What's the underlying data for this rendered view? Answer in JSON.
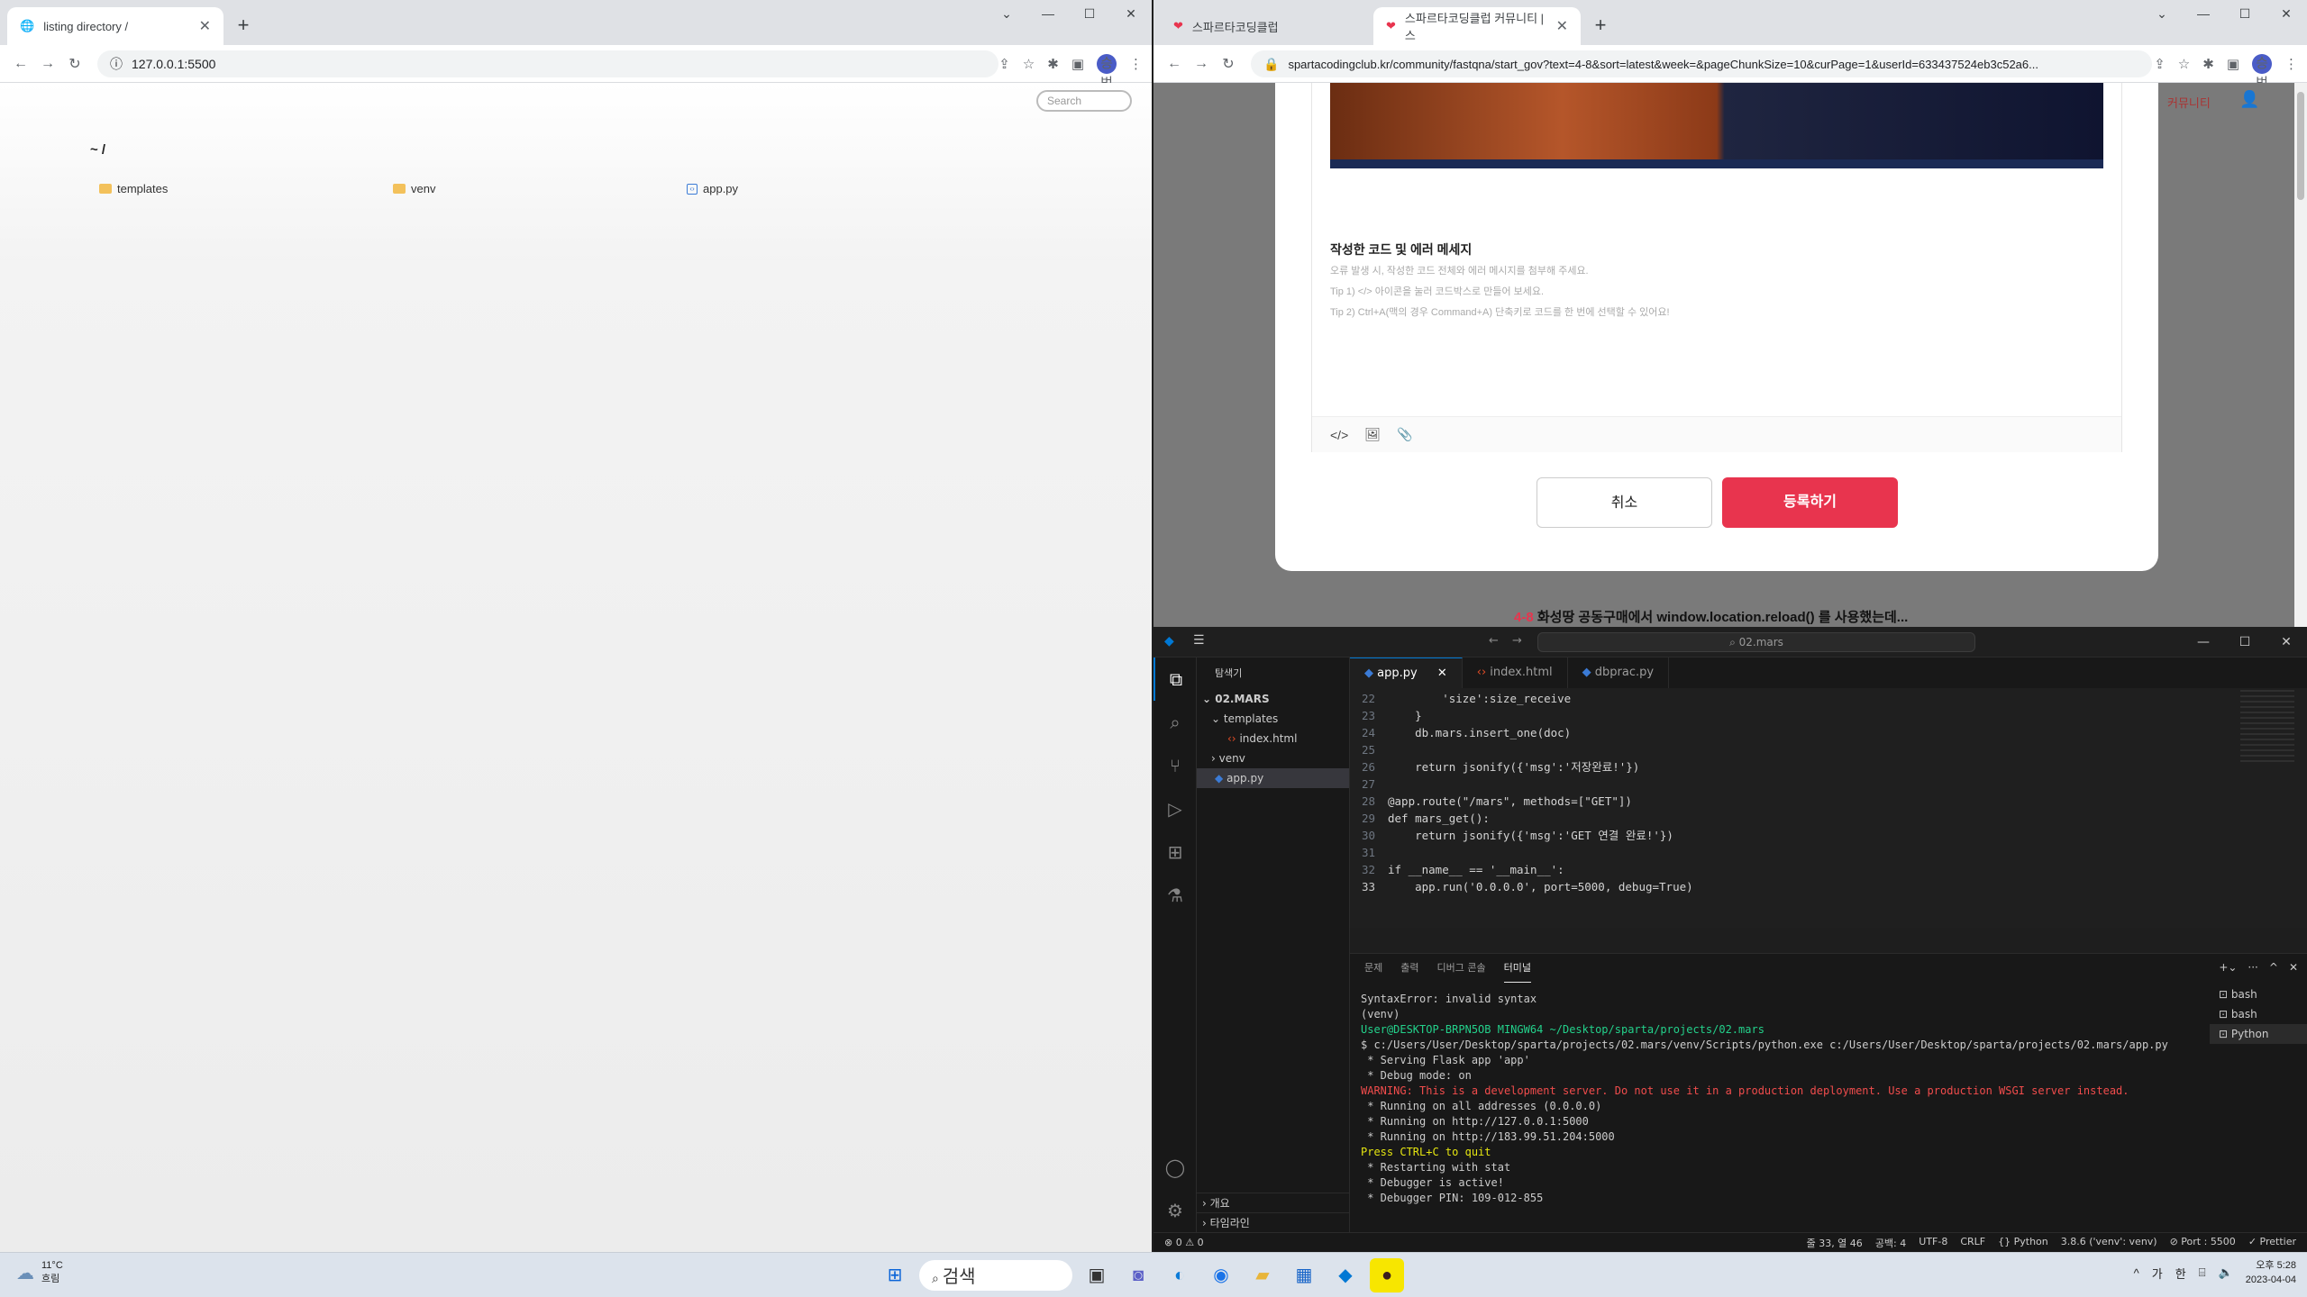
{
  "left_browser": {
    "tab_title": "listing directory /",
    "url": "127.0.0.1:5500",
    "avatar": "승범",
    "page": {
      "search_placeholder": "Search",
      "heading": "~ /",
      "items": [
        {
          "name": "templates",
          "type": "folder"
        },
        {
          "name": "venv",
          "type": "folder"
        },
        {
          "name": "app.py",
          "type": "file"
        }
      ]
    }
  },
  "right_browser": {
    "tabs": [
      "스파르타코딩클럽",
      "스파르타코딩클럽 커뮤니티 | 스"
    ],
    "url": "spartacodingclub.kr/community/fastqna/start_gov?text=4-8&sort=latest&week=&pageChunkSize=10&curPage=1&userId=633437524eb3c52a6...",
    "avatar": "승범",
    "bg_nav": "커뮤니티",
    "section_title": "작성한 코드 및 에러 메세지",
    "hints": [
      "오류 발생 시, 작성한 코드 전체와 에러 메시지를 첨부해 주세요.",
      "Tip 1) </> 아이콘을 눌러 코드박스로 만들어 보세요.",
      "Tip 2) Ctrl+A(맥의 경우 Command+A) 단축키로 코드를 한 번에 선택할 수 있어요!"
    ],
    "cancel_label": "취소",
    "submit_label": "등록하기",
    "below_prefix": "4-8",
    "below_text": " 화성땅 공동구매에서 window.location.reload() 를 사용했는데..."
  },
  "vscode": {
    "command_center": "02.mars",
    "explorer_title": "탐색기",
    "folder": "02.MARS",
    "tree": [
      {
        "label": "templates",
        "indent": 1,
        "kind": "folder-open"
      },
      {
        "label": "index.html",
        "indent": 2,
        "kind": "html"
      },
      {
        "label": "venv",
        "indent": 1,
        "kind": "folder"
      },
      {
        "label": "app.py",
        "indent": 1,
        "kind": "py",
        "selected": true
      }
    ],
    "outline": "개요",
    "timeline": "타임라인",
    "tabs": [
      {
        "label": "app.py",
        "active": true
      },
      {
        "label": "index.html",
        "active": false
      },
      {
        "label": "dbprac.py",
        "active": false
      }
    ],
    "code_lines": [
      {
        "n": "22",
        "t": "        'size':size_receive"
      },
      {
        "n": "23",
        "t": "    }"
      },
      {
        "n": "24",
        "t": "    db.mars.insert_one(doc)"
      },
      {
        "n": "25",
        "t": ""
      },
      {
        "n": "26",
        "t": "    return jsonify({'msg':'저장완료!'})"
      },
      {
        "n": "27",
        "t": ""
      },
      {
        "n": "28",
        "t": "@app.route(\"/mars\", methods=[\"GET\"])"
      },
      {
        "n": "29",
        "t": "def mars_get():"
      },
      {
        "n": "30",
        "t": "    return jsonify({'msg':'GET 연결 완료!'})"
      },
      {
        "n": "31",
        "t": ""
      },
      {
        "n": "32",
        "t": "if __name__ == '__main__':"
      },
      {
        "n": "33",
        "t": "    app.run('0.0.0.0', port=5000, debug=True)"
      }
    ],
    "panel_tabs": [
      "문제",
      "출력",
      "디버그 콘솔",
      "터미널"
    ],
    "terminal": [
      {
        "t": "SyntaxError: invalid syntax",
        "c": "#cccccc"
      },
      {
        "t": "(venv)",
        "c": "#cccccc"
      },
      {
        "t": "User@DESKTOP-BRPN5OB MINGW64 ~/Desktop/sparta/projects/02.mars",
        "c": "#23d18b"
      },
      {
        "t": "$ c:/Users/User/Desktop/sparta/projects/02.mars/venv/Scripts/python.exe c:/Users/User/Desktop/sparta/projects/02.mars/app.py",
        "c": "#cccccc"
      },
      {
        "t": " * Serving Flask app 'app'",
        "c": "#cccccc"
      },
      {
        "t": " * Debug mode: on",
        "c": "#cccccc"
      },
      {
        "t": "WARNING: This is a development server. Do not use it in a production deployment. Use a production WSGI server instead.",
        "c": "#f14c4c"
      },
      {
        "t": " * Running on all addresses (0.0.0.0)",
        "c": "#cccccc"
      },
      {
        "t": " * Running on http://127.0.0.1:5000",
        "c": "#cccccc"
      },
      {
        "t": " * Running on http://183.99.51.204:5000",
        "c": "#cccccc"
      },
      {
        "t": "Press CTRL+C to quit",
        "c": "#e5e510"
      },
      {
        "t": " * Restarting with stat",
        "c": "#cccccc"
      },
      {
        "t": " * Debugger is active!",
        "c": "#cccccc"
      },
      {
        "t": " * Debugger PIN: 109-012-855",
        "c": "#cccccc"
      }
    ],
    "terminals": [
      "bash",
      "bash",
      "Python"
    ],
    "status": {
      "errors": "⊗ 0 ⚠ 0",
      "items": [
        "줄 33, 열 46",
        "공백: 4",
        "UTF-8",
        "CRLF",
        "{} Python",
        "3.8.6 ('venv': venv)",
        "⊘ Port : 5500",
        "✓ Prettier"
      ]
    }
  },
  "taskbar": {
    "temp": "11°C",
    "weather": "흐림",
    "search": "검색",
    "ime": "가",
    "ime2": "한",
    "time": "오후 5:28",
    "date": "2023-04-04"
  },
  "colors": {
    "accent": "#e8344e",
    "vscode_blue": "#0078d4"
  }
}
